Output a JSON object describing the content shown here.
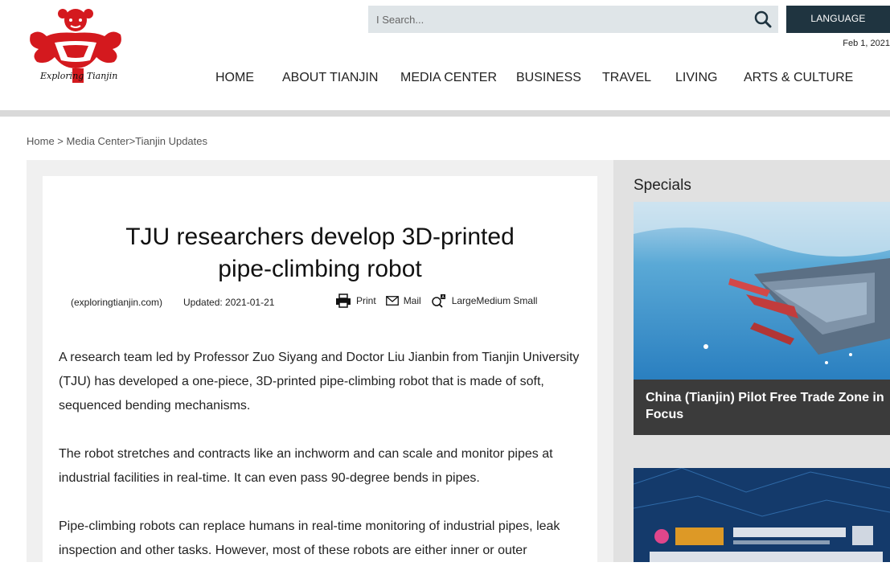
{
  "header": {
    "logo_text": "Exploring Tianjin",
    "search_placeholder": "I Search...",
    "language_label": "LANGUAGE",
    "date": "Feb 1, 2021"
  },
  "nav": {
    "items": [
      "HOME",
      "ABOUT TIANJIN",
      "MEDIA CENTER",
      "BUSINESS",
      "TRAVEL",
      "LIVING",
      "ARTS & CULTURE"
    ]
  },
  "breadcrumb": {
    "home": "Home",
    "sep1": " > ",
    "media": "Media Center",
    "sep2": ">",
    "section": "Tianjin Updates"
  },
  "article": {
    "title": "TJU researchers develop 3D-printed pipe-climbing robot",
    "source": "(exploringtianjin.com)",
    "updated": "Updated: 2021-01-21",
    "tools": {
      "print": "Print",
      "mail": "Mail",
      "size": "LargeMedium Small"
    },
    "paragraphs": [
      "A research team led by Professor Zuo Siyang and Doctor Liu Jianbin from Tianjin University (TJU) has developed a one-piece, 3D-printed pipe-climbing robot that is made of soft, sequenced bending mechanisms.",
      "The robot stretches and contracts like an inchworm and can scale and monitor pipes at industrial facilities in real-time. It can even pass 90-degree bends in pipes.",
      "Pipe-climbing robots can replace humans in real-time monitoring of industrial pipes, leak inspection and other tasks. However, most of these robots are either inner or outer"
    ]
  },
  "specials": {
    "title": "Specials",
    "cards": [
      {
        "caption": "China (Tianjin) Pilot Free Trade Zone in Focus"
      },
      {
        "caption": ""
      }
    ]
  },
  "colors": {
    "nav_dark": "#1f3440",
    "search_bg": "#dfe5e8",
    "header_rule": "#d9d9d9",
    "content_bg": "#f0f0f0",
    "specials_bg": "#e1e1e1",
    "card_caption_bg": "#3b3b3b",
    "logo_red": "#d4191e"
  }
}
